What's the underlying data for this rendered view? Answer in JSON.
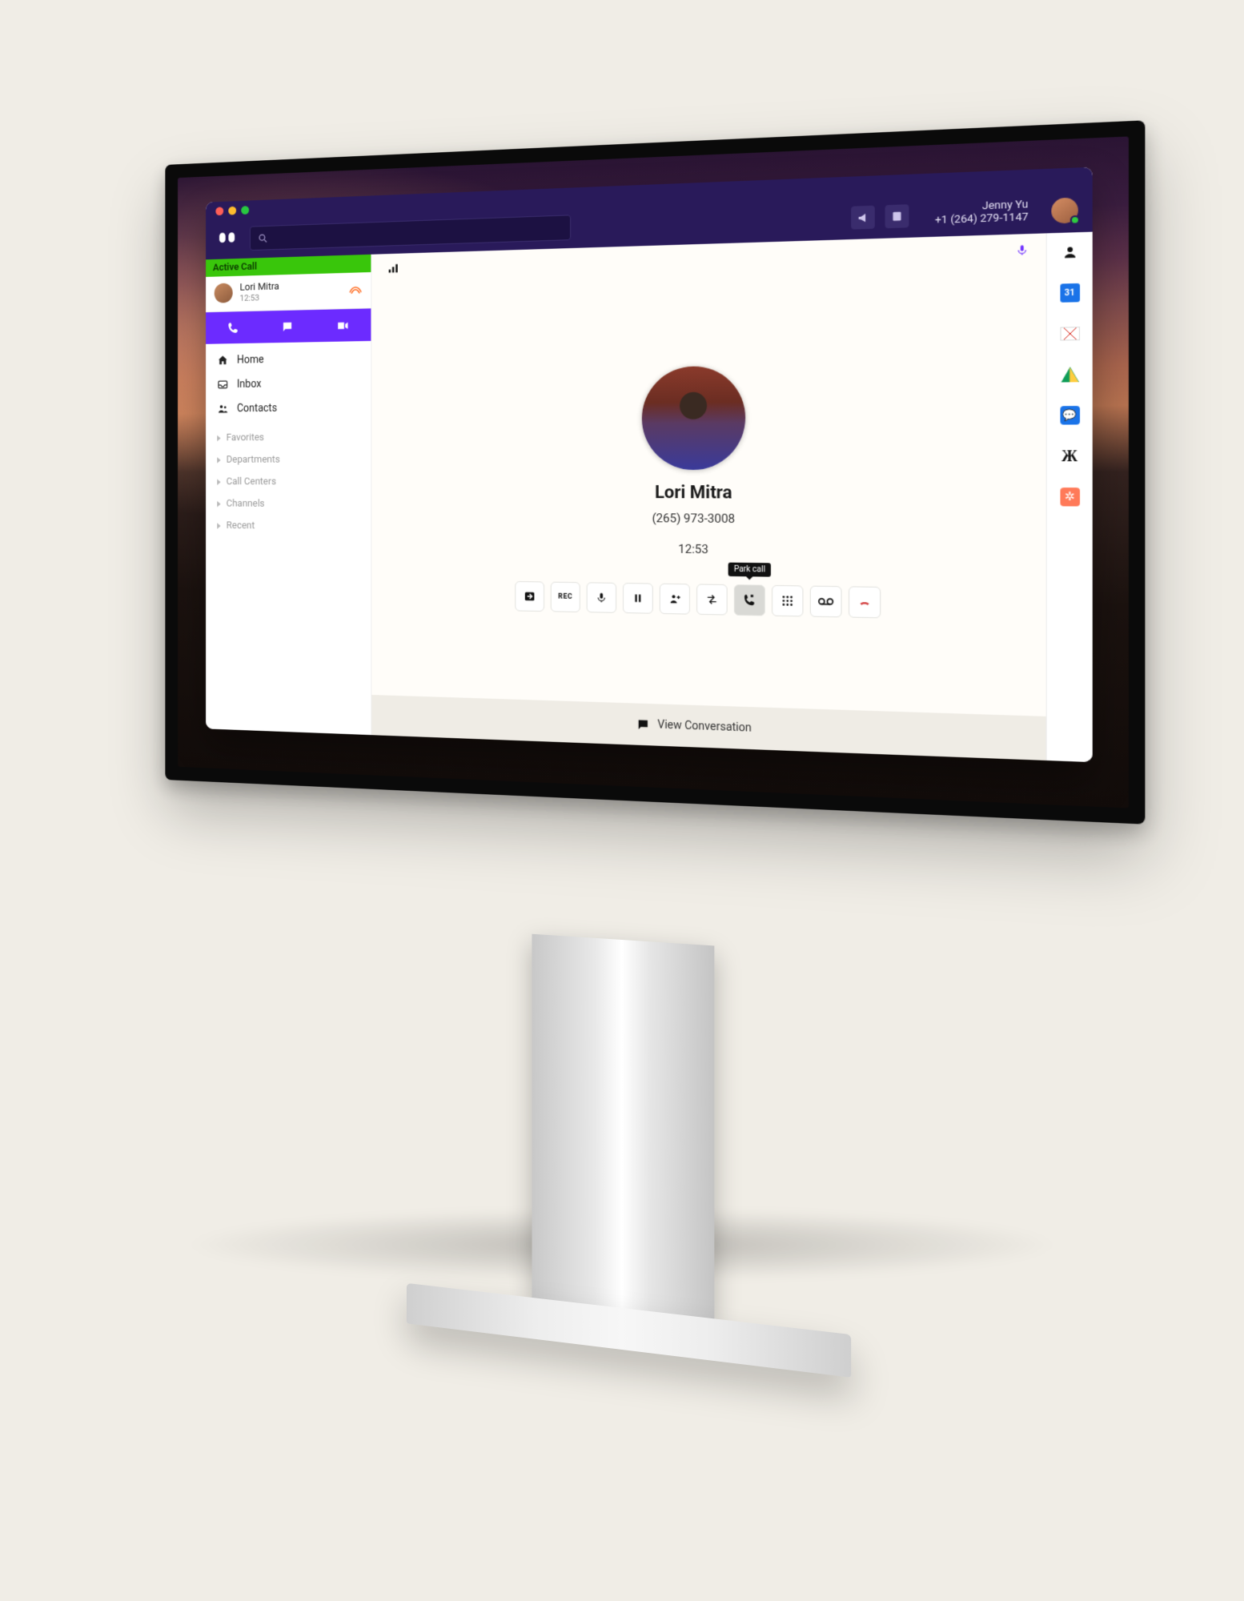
{
  "header": {
    "user_name": "Jenny Yu",
    "user_number": "+1 (264) 279-1147"
  },
  "sidebar": {
    "active_call_label": "Active Call",
    "caller_name": "Lori Mitra",
    "caller_time": "12:53",
    "nav": [
      {
        "label": "Home"
      },
      {
        "label": "Inbox"
      },
      {
        "label": "Contacts"
      }
    ],
    "groups": [
      {
        "label": "Favorites"
      },
      {
        "label": "Departments"
      },
      {
        "label": "Call Centers"
      },
      {
        "label": "Channels"
      },
      {
        "label": "Recent"
      }
    ]
  },
  "call": {
    "name": "Lori Mitra",
    "number": "(265) 973-3008",
    "duration": "12:53",
    "tooltip_park": "Park call",
    "view_conversation": "View Conversation"
  },
  "rail": {
    "cal": "31"
  }
}
